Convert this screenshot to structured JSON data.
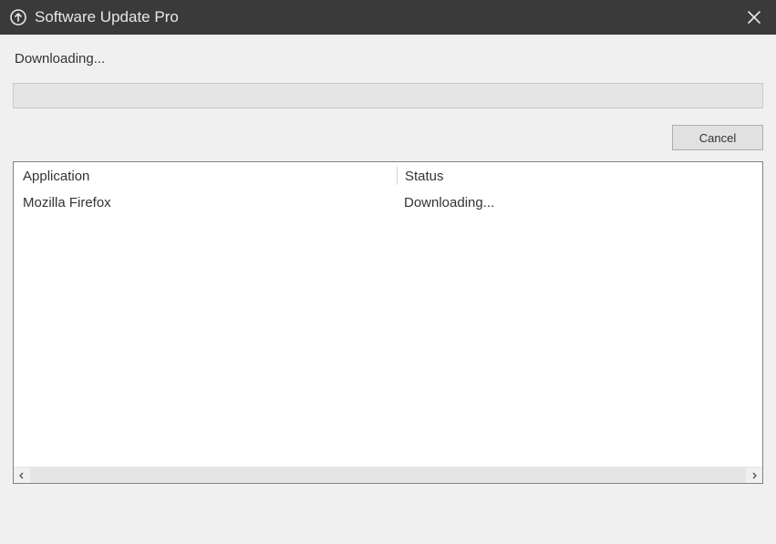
{
  "window": {
    "title": "Software Update Pro"
  },
  "status": {
    "label": "Downloading..."
  },
  "buttons": {
    "cancel": "Cancel"
  },
  "table": {
    "headers": {
      "application": "Application",
      "status": "Status"
    },
    "rows": [
      {
        "application": "Mozilla Firefox",
        "status": "Downloading..."
      }
    ]
  }
}
